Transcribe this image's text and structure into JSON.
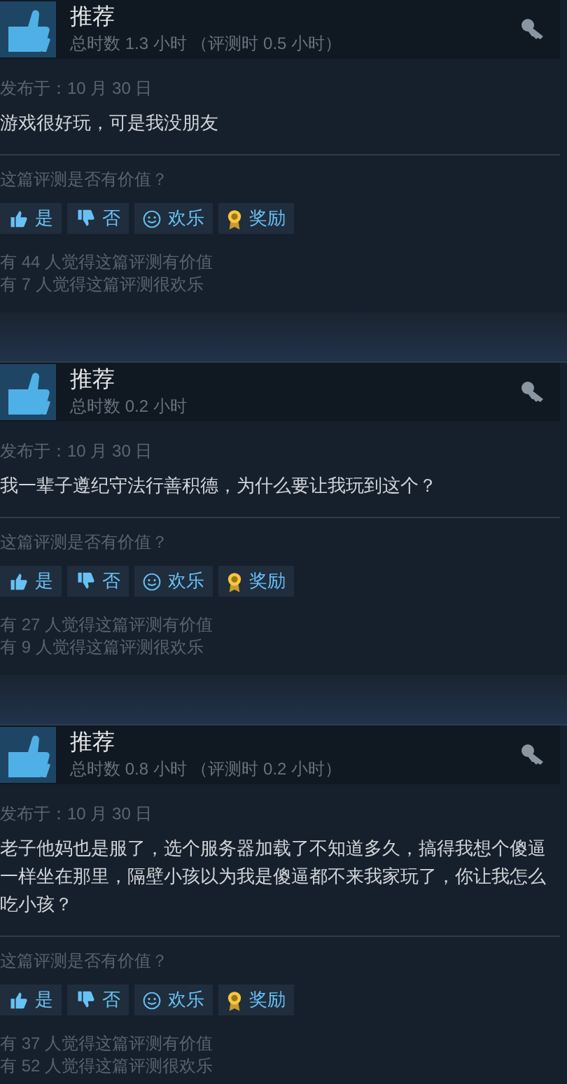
{
  "reviews": [
    {
      "verdict": "推荐",
      "hours": "总时数 1.3 小时 （评测时 0.5 小时）",
      "posted": "发布于：10 月 30 日",
      "body": "游戏很好玩，可是我没朋友",
      "prompt": "这篇评测是否有价值？",
      "buttons": [
        {
          "kind": "yes",
          "label": "是"
        },
        {
          "kind": "no",
          "label": "否"
        },
        {
          "kind": "funny",
          "label": "欢乐"
        },
        {
          "kind": "award",
          "label": "奖励"
        }
      ],
      "stats": [
        "有 44 人觉得这篇评测有价值",
        "有 7 人觉得这篇评测很欢乐"
      ]
    },
    {
      "verdict": "推荐",
      "hours": "总时数 0.2 小时",
      "posted": "发布于：10 月 30 日",
      "body": "我一辈子遵纪守法行善积德，为什么要让我玩到这个？",
      "prompt": "这篇评测是否有价值？",
      "buttons": [
        {
          "kind": "yes",
          "label": "是"
        },
        {
          "kind": "no",
          "label": "否"
        },
        {
          "kind": "funny",
          "label": "欢乐"
        },
        {
          "kind": "award",
          "label": "奖励"
        }
      ],
      "stats": [
        "有 27 人觉得这篇评测有价值",
        "有 9 人觉得这篇评测很欢乐"
      ]
    },
    {
      "verdict": "推荐",
      "hours": "总时数 0.8 小时 （评测时 0.2 小时）",
      "posted": "发布于：10 月 30 日",
      "body": "老子他妈也是服了，选个服务器加载了不知道多久，搞得我想个傻逼一样坐在那里，隔壁小孩以为我是傻逼都不来我家玩了，你让我怎么吃小孩？",
      "prompt": "这篇评测是否有价值？",
      "buttons": [
        {
          "kind": "yes",
          "label": "是"
        },
        {
          "kind": "no",
          "label": "否"
        },
        {
          "kind": "funny",
          "label": "欢乐"
        },
        {
          "kind": "award",
          "label": "奖励"
        }
      ],
      "stats": [
        "有 37 人觉得这篇评测有价值",
        "有 52 人觉得这篇评测很欢乐"
      ]
    }
  ]
}
